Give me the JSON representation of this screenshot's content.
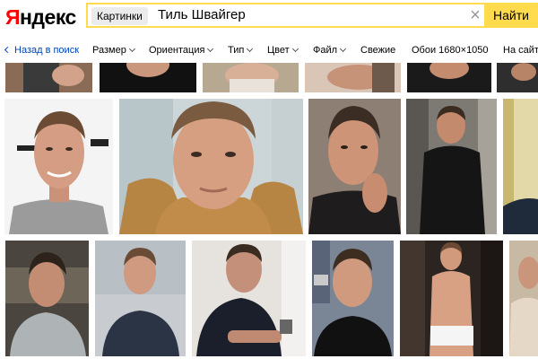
{
  "header": {
    "logo": "Яндекс",
    "service_chip": "Картинки",
    "query": "Тиль Швайгер",
    "search_button": "Найти"
  },
  "filters": {
    "back": "Назад в поиск",
    "size": "Размер",
    "orientation": "Ориентация",
    "type": "Тип",
    "color": "Цвет",
    "file": "Файл",
    "fresh": "Свежие",
    "wallpaper": "Обои 1680×1050",
    "on_site": "На сайт"
  },
  "colors": {
    "search_accent": "#ffdb4d",
    "logo_red": "#ff0000",
    "link_blue": "#0044bb"
  }
}
